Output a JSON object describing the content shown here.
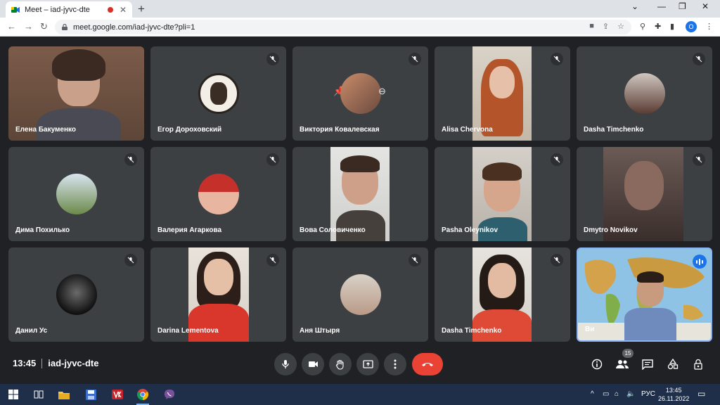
{
  "browser": {
    "tab_title": "Meet – iad-jyvc-dte",
    "url": "meet.google.com/iad-jyvc-dte?pli=1",
    "profile_initial": "O"
  },
  "meeting": {
    "time": "13:45",
    "code": "iad-jyvc-dte",
    "participant_count": "15"
  },
  "tiles": [
    {
      "name": "Елена Бакуменко"
    },
    {
      "name": "Егор Дороховский"
    },
    {
      "name": "Виктория Ковалевская"
    },
    {
      "name": "Alisa Chervona"
    },
    {
      "name": "Dasha Timchenko"
    },
    {
      "name": "Дима Похилько"
    },
    {
      "name": "Валерия Агаркова"
    },
    {
      "name": "Вова Соловиченко"
    },
    {
      "name": "Pasha Oleynikov"
    },
    {
      "name": "Dmytro Novikov"
    },
    {
      "name": "Данил Ус"
    },
    {
      "name": "Darina Lementova"
    },
    {
      "name": "Аня Штыря"
    },
    {
      "name": "Dasha Timchenko"
    },
    {
      "name": "Ви"
    }
  ],
  "taskbar": {
    "language": "РУС",
    "clock_time": "13:45",
    "clock_date": "26.11.2022"
  },
  "colors": {
    "meet_bg": "#202124",
    "tile_bg": "#3c4043",
    "end_call": "#ea4335",
    "active_speaker": "#8ab4f8"
  }
}
